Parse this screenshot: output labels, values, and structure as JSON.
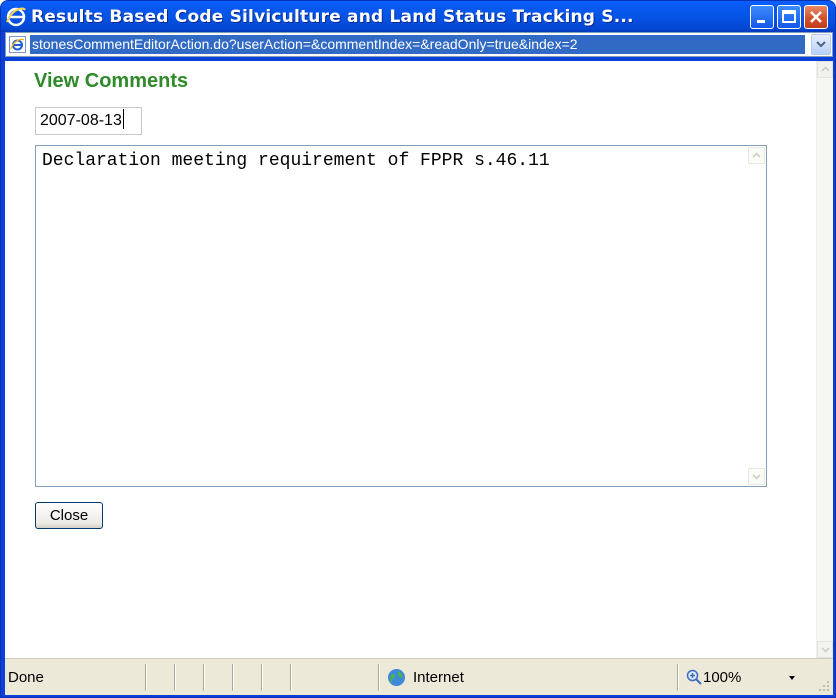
{
  "window": {
    "title": "Results Based Code Silviculture and Land Status Tracking S...",
    "title_icon": "ie-icon",
    "controls": [
      "minimize-icon",
      "maximize-icon",
      "close-icon"
    ]
  },
  "address_bar": {
    "url": "stonesCommentEditorAction.do?userAction=&commentIndex=&readOnly=true&index=2",
    "page_icon": "ie-page-icon",
    "dropdown_icon": "chevron-down-icon"
  },
  "page": {
    "heading": "View Comments",
    "date_value": "2007-08-13",
    "comment_text": "Declaration meeting requirement of FPPR s.46.11",
    "close_label": "Close"
  },
  "status_bar": {
    "status": "Done",
    "zone_label": "Internet",
    "zone_icon": "globe-icon",
    "zoom_label": "100%",
    "zoom_icon": "zoom-icon"
  },
  "colors": {
    "titlebar": "#0a5bf4",
    "heading": "#2f8a2a",
    "url_highlight": "#316ac5",
    "statusbar": "#ece9d8"
  }
}
